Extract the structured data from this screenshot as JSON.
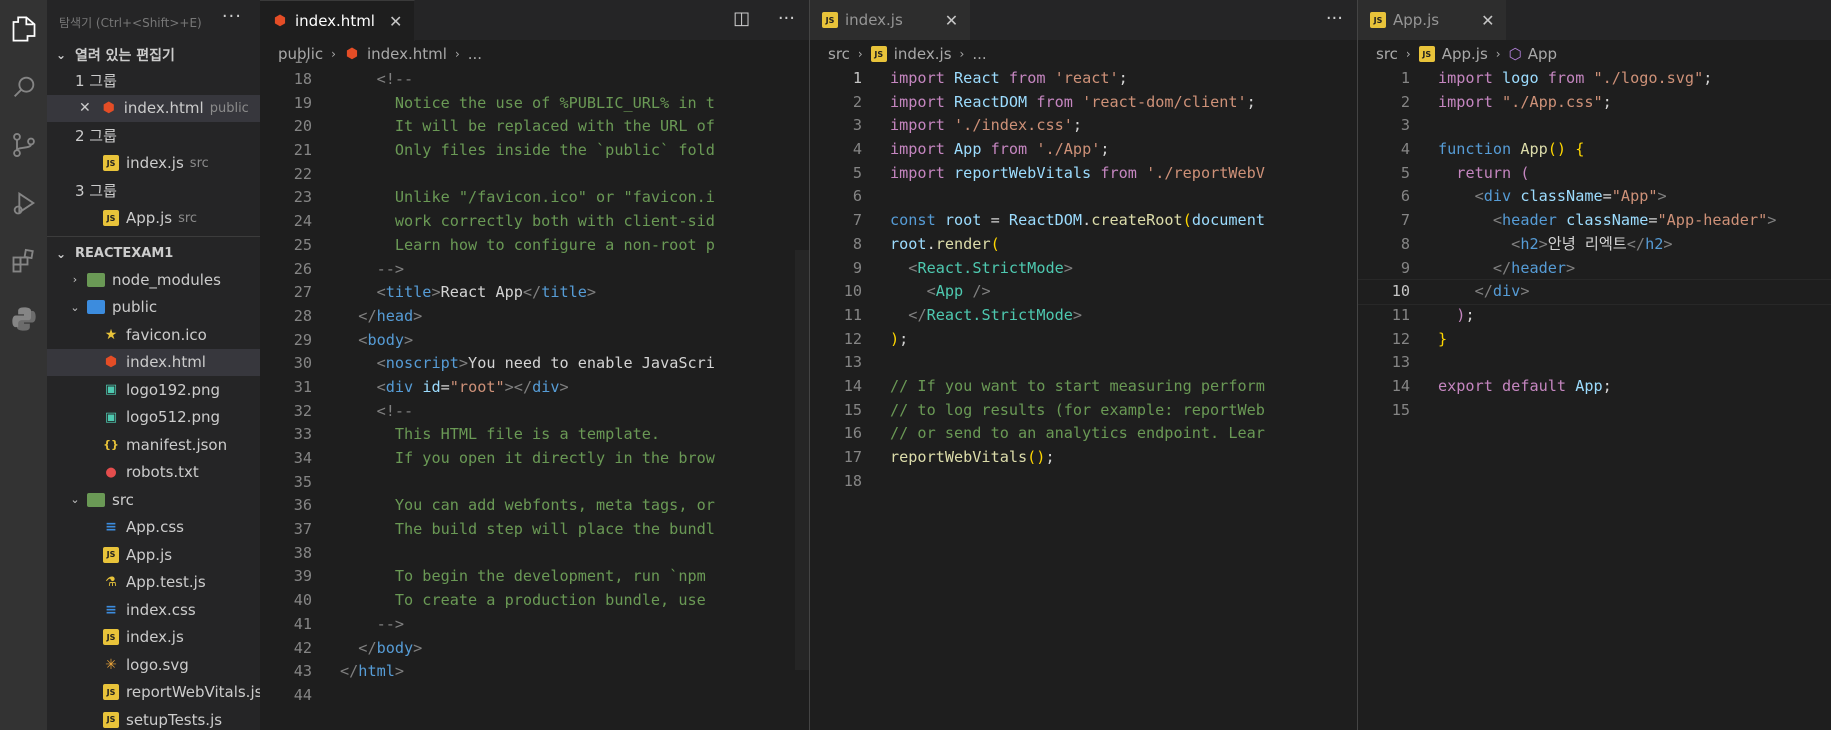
{
  "sidebar": {
    "tooltip": "탐색기 (Ctrl+<Shift>+E)",
    "open_editors_title": "열려 있는 편집기",
    "groups": [
      {
        "label": "1 그룹",
        "file": "index.html",
        "hint": "public"
      },
      {
        "label": "2 그룹",
        "file": "index.js",
        "hint": "src"
      },
      {
        "label": "3 그룹",
        "file": "App.js",
        "hint": "src"
      }
    ],
    "project_title": "REACTEXAM1",
    "tree": {
      "node_modules": "node_modules",
      "public": "public",
      "public_files": [
        "favicon.ico",
        "index.html",
        "logo192.png",
        "logo512.png",
        "manifest.json",
        "robots.txt"
      ],
      "src": "src",
      "src_files": [
        "App.css",
        "App.js",
        "App.test.js",
        "index.css",
        "index.js",
        "logo.svg",
        "reportWebVitals.js",
        "setupTests.js"
      ]
    }
  },
  "editor1": {
    "tab": "index.html",
    "crumb": [
      "public",
      "index.html",
      "..."
    ]
  },
  "editor2": {
    "tab": "index.js",
    "crumb": [
      "src",
      "index.js",
      "..."
    ]
  },
  "editor3": {
    "tab": "App.js",
    "crumb": [
      "src",
      "App.js",
      "App"
    ]
  },
  "colors": {
    "sidebar": "#252526",
    "editor": "#1e1e1e",
    "activity": "#333333"
  }
}
